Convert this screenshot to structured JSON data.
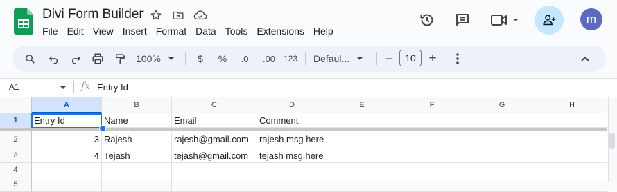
{
  "doc": {
    "title": "Divi Form Builder"
  },
  "menu": [
    "File",
    "Edit",
    "View",
    "Insert",
    "Format",
    "Data",
    "Tools",
    "Extensions",
    "Help"
  ],
  "header_icons": [
    "star-icon",
    "move-to-folder-icon",
    "cloud-saved-icon",
    "version-history-icon",
    "comments-icon",
    "meet-video-icon",
    "share-add-person-icon"
  ],
  "user": {
    "avatar_letter": "m",
    "avatar_color": "#5c6bc0"
  },
  "toolbar": {
    "zoom": "100%",
    "currency": "$",
    "percent": "%",
    "decrease_decimal": ".0",
    "increase_decimal": ".00",
    "number_format": "123",
    "font": "Defaul...",
    "font_size": "10",
    "minus": "−",
    "plus": "+"
  },
  "formula_bar": {
    "cell_ref": "A1",
    "fx": "fx",
    "content": "Entry Id"
  },
  "grid": {
    "columns": [
      "A",
      "B",
      "C",
      "D",
      "E",
      "F",
      "G",
      "H"
    ],
    "rows": [
      "1",
      "2",
      "3",
      "4",
      "5"
    ],
    "cells": [
      [
        "Entry Id",
        "Name",
        "Email",
        "Comment",
        "",
        "",
        "",
        ""
      ],
      [
        "3",
        "Rajesh",
        "rajesh@gmail.com",
        "rajesh msg here",
        "",
        "",
        "",
        ""
      ],
      [
        "4",
        "Tejash",
        "tejash@gmail.com",
        "tejash msg here",
        "",
        "",
        "",
        ""
      ],
      [
        "",
        "",
        "",
        "",
        "",
        "",
        "",
        ""
      ],
      [
        "",
        "",
        "",
        "",
        "",
        "",
        "",
        ""
      ]
    ],
    "selected_cell": "A1"
  },
  "colors": {
    "accent": "#1a73e8",
    "share_bg": "#c2e7ff",
    "sheets_green": "#0f9d58"
  }
}
